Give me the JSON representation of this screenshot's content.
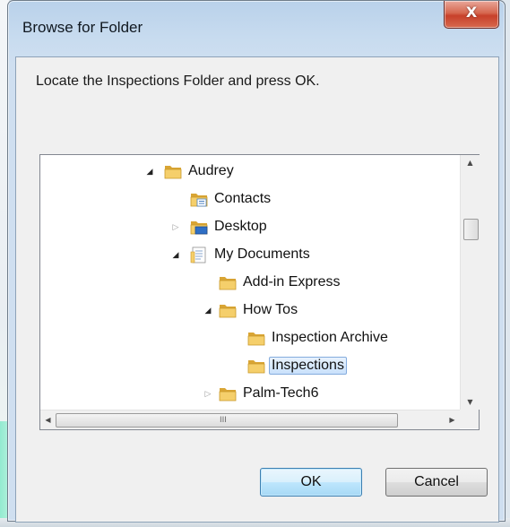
{
  "window": {
    "title": "Browse for Folder",
    "close_glyph": "X"
  },
  "instruction": "Locate the Inspections Folder and press OK.",
  "tree": {
    "nodes": [
      {
        "label": "Audrey",
        "icon": "folder-icon",
        "expander": "expanded"
      },
      {
        "label": "Contacts",
        "icon": "contacts-folder-icon",
        "expander": "none"
      },
      {
        "label": "Desktop",
        "icon": "desktop-folder-icon",
        "expander": "collapsed"
      },
      {
        "label": "My Documents",
        "icon": "documents-folder-icon",
        "expander": "expanded"
      },
      {
        "label": "Add-in Express",
        "icon": "folder-icon",
        "expander": "none"
      },
      {
        "label": "How Tos",
        "icon": "folder-icon",
        "expander": "expanded"
      },
      {
        "label": "Inspection Archive",
        "icon": "folder-icon",
        "expander": "none"
      },
      {
        "label": "Inspections",
        "icon": "folder-icon",
        "expander": "none",
        "selected": true
      },
      {
        "label": "Palm-Tech6",
        "icon": "folder-icon",
        "expander": "collapsed"
      }
    ]
  },
  "scrollbars": {
    "horizontal_grip": "III"
  },
  "buttons": {
    "ok_label": "OK",
    "cancel_label": "Cancel"
  },
  "colors": {
    "selection_border": "#84acdd",
    "folder_yellow": "#f0c65a",
    "close_red": "#c7402a"
  }
}
